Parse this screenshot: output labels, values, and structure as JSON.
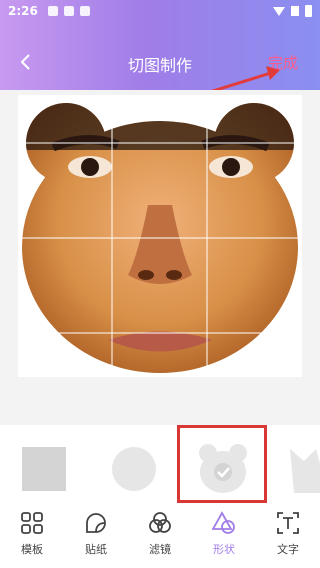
{
  "status": {
    "time": "2:26"
  },
  "nav": {
    "title": "切图制作",
    "done": "完成"
  },
  "tabs": [
    {
      "label": "模板"
    },
    {
      "label": "贴纸"
    },
    {
      "label": "滤镜"
    },
    {
      "label": "形状"
    },
    {
      "label": "文字"
    }
  ],
  "colors": {
    "accent": "#a07de8",
    "done": "#ff5a8c",
    "highlight": "#d93636",
    "arrow": "#e23b3b"
  }
}
